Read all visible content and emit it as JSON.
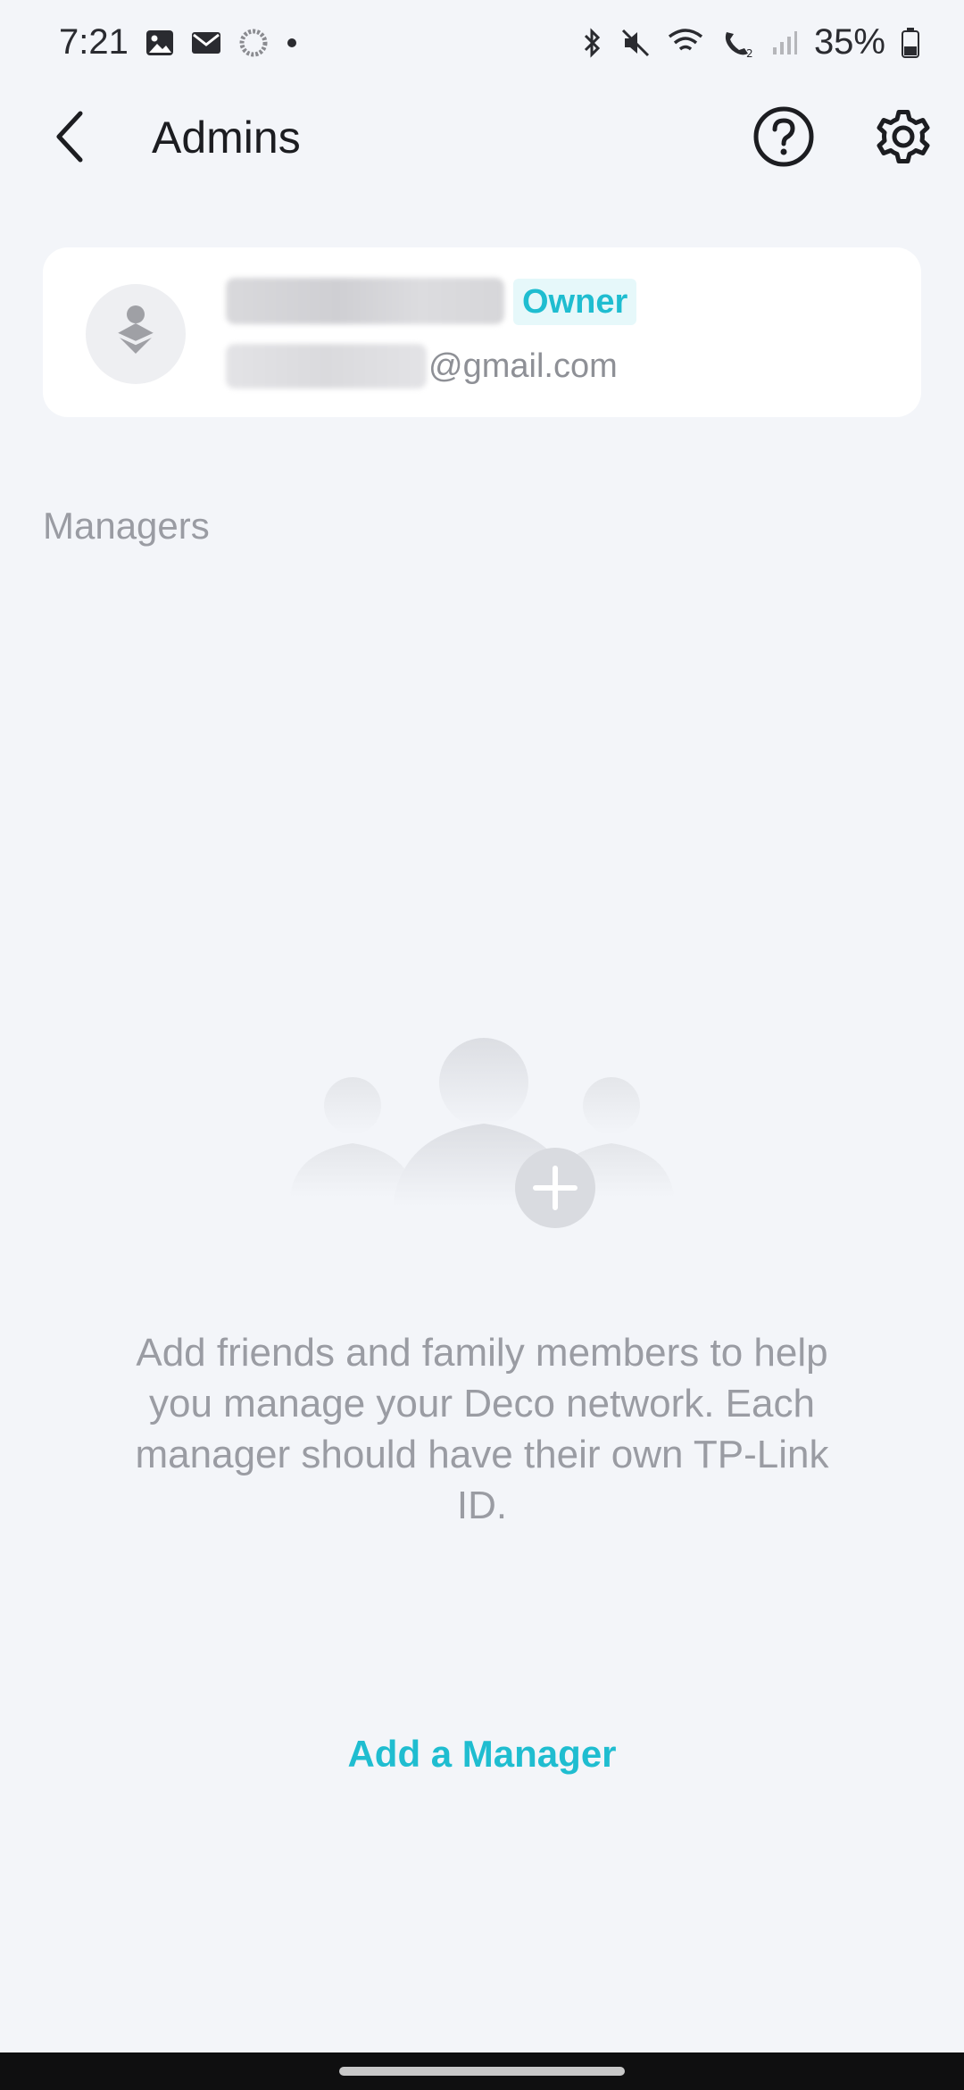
{
  "status_bar": {
    "time": "7:21",
    "battery": "35%",
    "icons_left": [
      "gallery-icon",
      "mail-icon",
      "sync-icon",
      "dot-icon"
    ],
    "icons_right": [
      "bluetooth-icon",
      "mute-icon",
      "wifi-icon",
      "wifi-call-icon",
      "signal-icon",
      "battery-icon"
    ]
  },
  "header": {
    "title": "Admins",
    "icons": [
      "back-arrow-icon",
      "help-icon",
      "gear-icon"
    ]
  },
  "owner": {
    "badge": "Owner",
    "email_domain": "@gmail.com"
  },
  "managers": {
    "section_label": "Managers",
    "empty_message": "Add friends and family members to help you manage your Deco network. Each manager should have their own TP-Link ID.",
    "add_button_label": "Add a Manager"
  },
  "colors": {
    "accent": "#1fbdd0",
    "background": "#f3f5f9",
    "card": "#ffffff",
    "muted_text": "#9a9ca3"
  }
}
